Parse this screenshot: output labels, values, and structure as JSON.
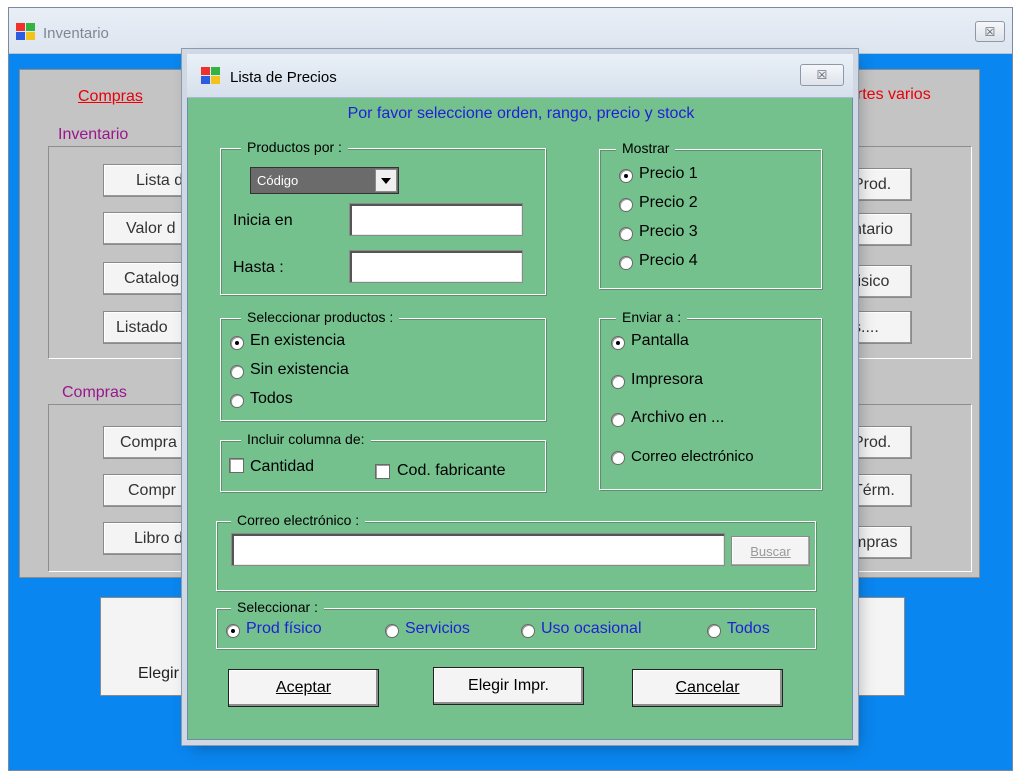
{
  "main_window": {
    "title": "Inventario",
    "close_glyph": "☒",
    "tabs": {
      "left": "Compras",
      "right": "Reportes varios"
    },
    "groups": {
      "inventario": "Inventario",
      "compras": "Compras"
    },
    "left_buttons": [
      "Lista d",
      "Valor d",
      "Catalog",
      "Listado",
      "Compra",
      "Compr",
      "Libro d"
    ],
    "right_buttons": [
      "Prod.",
      "ntario",
      "fisico",
      "s....",
      "Prod.",
      "Térm.",
      "mpras"
    ],
    "big_button_label": "Elegir"
  },
  "dialog": {
    "title": "Lista de Precios",
    "subtitle": "Por favor seleccione orden, rango, precio y stock",
    "productos_por": {
      "label": "Productos por :",
      "selected": "Código",
      "inicia_en_label": "Inicia en",
      "inicia_en_value": "",
      "hasta_label": "Hasta :",
      "hasta_value": ""
    },
    "mostrar": {
      "label": "Mostrar",
      "options": [
        "Precio 1",
        "Precio 2",
        "Precio 3",
        "Precio 4"
      ],
      "selected_index": 0
    },
    "seleccionar_productos": {
      "label": "Seleccionar productos :",
      "options": [
        "En existencia",
        "Sin existencia",
        "Todos"
      ],
      "selected_index": 0
    },
    "enviar_a": {
      "label": "Enviar a :",
      "options": [
        "Pantalla",
        "Impresora",
        "Archivo en ...",
        "Correo electrónico"
      ],
      "selected_index": 0
    },
    "incluir_columna": {
      "label": "Incluir columna de:",
      "cantidad": "Cantidad",
      "cod_fabricante": "Cod. fabricante"
    },
    "correo": {
      "label": "Correo electrónico :",
      "value": "",
      "buscar": "Buscar"
    },
    "seleccionar": {
      "label": "Seleccionar :",
      "options": [
        "Prod físico",
        "Servicios",
        "Uso ocasional",
        "Todos"
      ],
      "selected_index": 0
    },
    "buttons": {
      "aceptar": "Aceptar",
      "elegir_impr": "Elegir Impr.",
      "cancelar": "Cancelar"
    }
  },
  "colors": {
    "dialog_bg": "#74c18d",
    "main_bg": "#0a86f0",
    "panel_bg": "#c4c4c4",
    "accent_text": "#1f1fd8",
    "tab_red": "#e8000a",
    "group_purple": "#9a168c"
  }
}
